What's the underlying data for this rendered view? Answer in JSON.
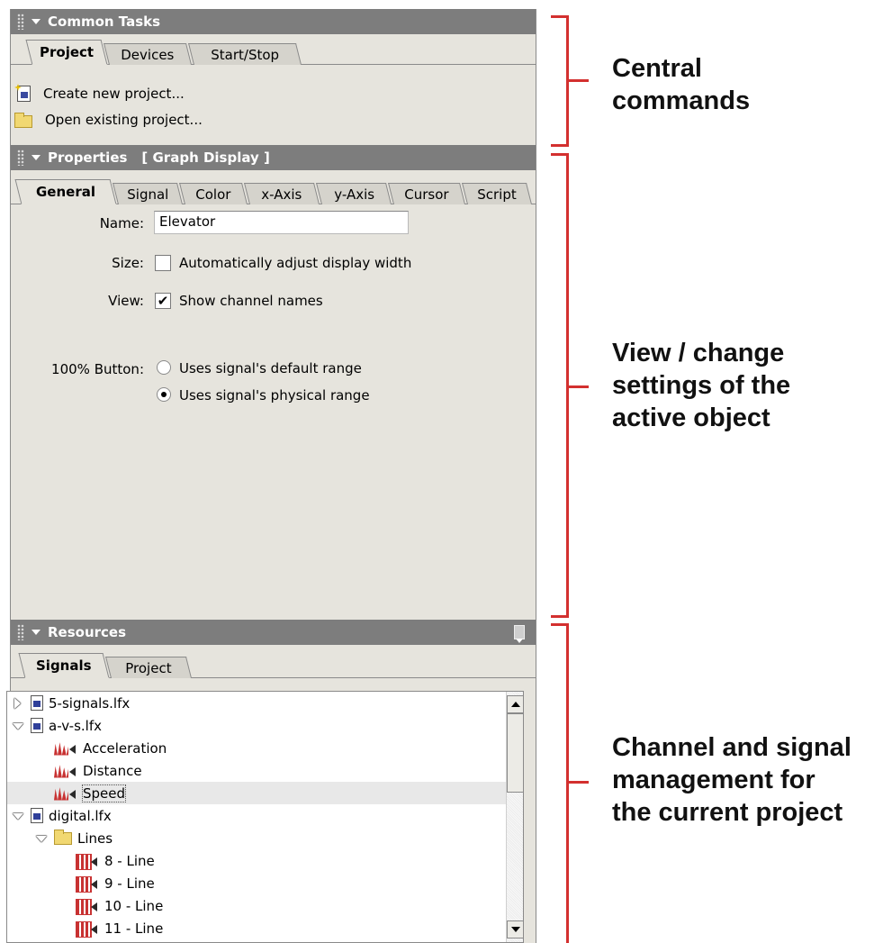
{
  "common_tasks": {
    "title": "Common Tasks",
    "tabs": [
      "Project",
      "Devices",
      "Start/Stop"
    ],
    "items": [
      "Create new project...",
      "Open existing project..."
    ]
  },
  "properties": {
    "title": "Properties",
    "context": "[ Graph Display ]",
    "tabs": [
      "General",
      "Signal",
      "Color",
      "x-Axis",
      "y-Axis",
      "Cursor",
      "Script"
    ],
    "name_label": "Name:",
    "name_value": "Elevator",
    "size_label": "Size:",
    "size_option": "Automatically adjust display width",
    "size_checked": false,
    "view_label": "View:",
    "view_option": "Show channel names",
    "view_checked": true,
    "button_label": "100% Button:",
    "range_options": [
      "Uses signal's default range",
      "Uses signal's physical range"
    ],
    "range_selected": 1
  },
  "resources": {
    "title": "Resources",
    "tabs": [
      "Signals",
      "Project"
    ],
    "tree": [
      {
        "label": "5-signals.lfx",
        "expanded": false
      },
      {
        "label": "a-v-s.lfx",
        "expanded": true
      },
      {
        "label": "Acceleration"
      },
      {
        "label": "Distance"
      },
      {
        "label": "Speed",
        "selected": true
      },
      {
        "label": "digital.lfx",
        "expanded": true
      },
      {
        "label": "Lines",
        "expanded": true
      },
      {
        "label": "8 - Line"
      },
      {
        "label": "9 - Line"
      },
      {
        "label": "10 - Line"
      },
      {
        "label": "11 - Line"
      }
    ]
  },
  "annotations": {
    "central": [
      "Central",
      "commands"
    ],
    "view": [
      "View / change",
      "settings of the",
      "active object"
    ],
    "channel": [
      "Channel and signal",
      "management for",
      "the current project"
    ],
    "color": "#d3302f"
  },
  "colors": {
    "panel_header": "#7d7d7d",
    "panel_bg": "#e6e4dd",
    "accent_red": "#d3302f"
  }
}
